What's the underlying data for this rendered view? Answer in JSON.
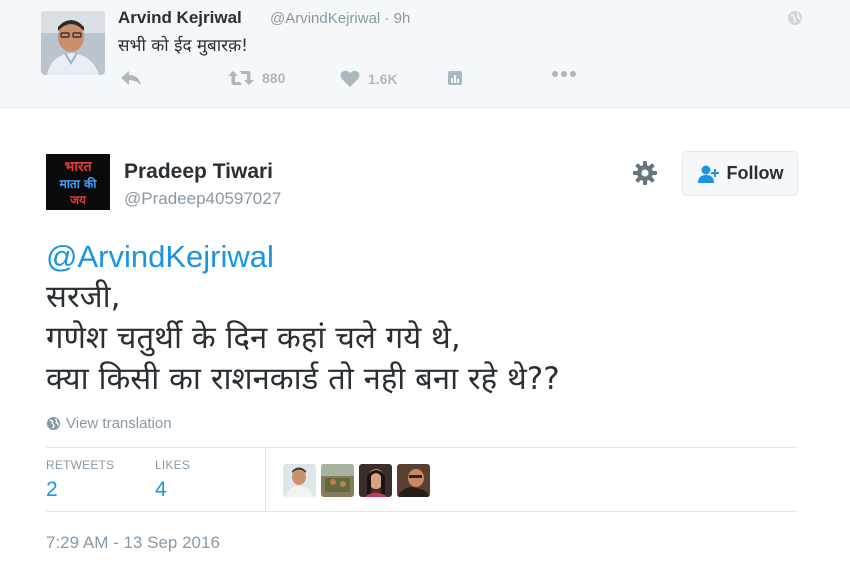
{
  "parent_tweet": {
    "name": "Arvind Kejriwal",
    "handle": "@ArvindKejriwal",
    "time": "· 9h",
    "text": "सभी को ईद मुबारक़!",
    "retweets": "880",
    "likes": "1.6K"
  },
  "tweet": {
    "name": "Pradeep Tiwari",
    "handle": "@Pradeep40597027",
    "avatar_lines": [
      "भारत",
      "माता की",
      "जय"
    ],
    "follow_label": "Follow",
    "mention": "@ArvindKejriwal",
    "lines": [
      "सरजी,",
      "गणेश चतुर्थी के दिन कहां चले गये थे,",
      "क्या किसी का राशनकार्ड तो नही बना रहे थे??"
    ],
    "view_translation": "View translation",
    "retweets_label": "RETWEETS",
    "retweets_count": "2",
    "likes_label": "LIKES",
    "likes_count": "4",
    "timestamp": "7:29 AM - 13 Sep 2016"
  },
  "colors": {
    "link": "#1b95e0",
    "muted": "#8899a6",
    "icon": "#aab8c2",
    "text": "#292f33"
  }
}
